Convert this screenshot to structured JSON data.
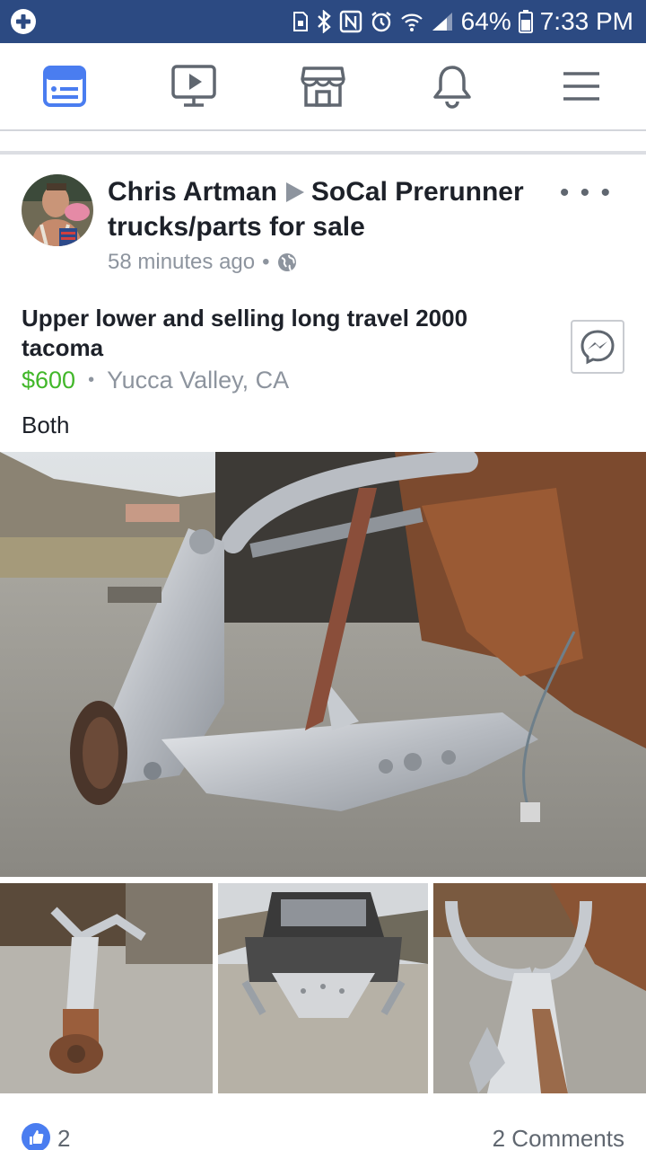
{
  "status_bar": {
    "battery": "64%",
    "time": "7:33 PM",
    "icons": [
      "plus-badge-icon",
      "sim-icon",
      "bluetooth-icon",
      "nfc-icon",
      "alarm-icon",
      "wifi-icon",
      "signal-icon",
      "battery-icon"
    ]
  },
  "nav": {
    "items": [
      {
        "name": "news-feed",
        "icon": "news-feed-icon",
        "active": true
      },
      {
        "name": "watch",
        "icon": "video-icon"
      },
      {
        "name": "marketplace",
        "icon": "marketplace-icon"
      },
      {
        "name": "notifications",
        "icon": "bell-icon"
      },
      {
        "name": "menu",
        "icon": "hamburger-icon"
      }
    ],
    "active_color": "#4a7df0"
  },
  "post": {
    "author": "Chris Artman",
    "group": "SoCal Prerunner trucks/parts for sale",
    "time": "58 minutes ago",
    "more": "• • •",
    "title": "Upper lower and selling long travel 2000 tacoma",
    "price": "$600",
    "separator": "•",
    "location": "Yucca Valley, CA",
    "body": "Both",
    "likes": "2",
    "comments": "2 Comments"
  },
  "colors": {
    "status_bar": "#2c4a82",
    "price": "#42b72a",
    "meta": "#8d949e",
    "like": "#4a7df0"
  }
}
